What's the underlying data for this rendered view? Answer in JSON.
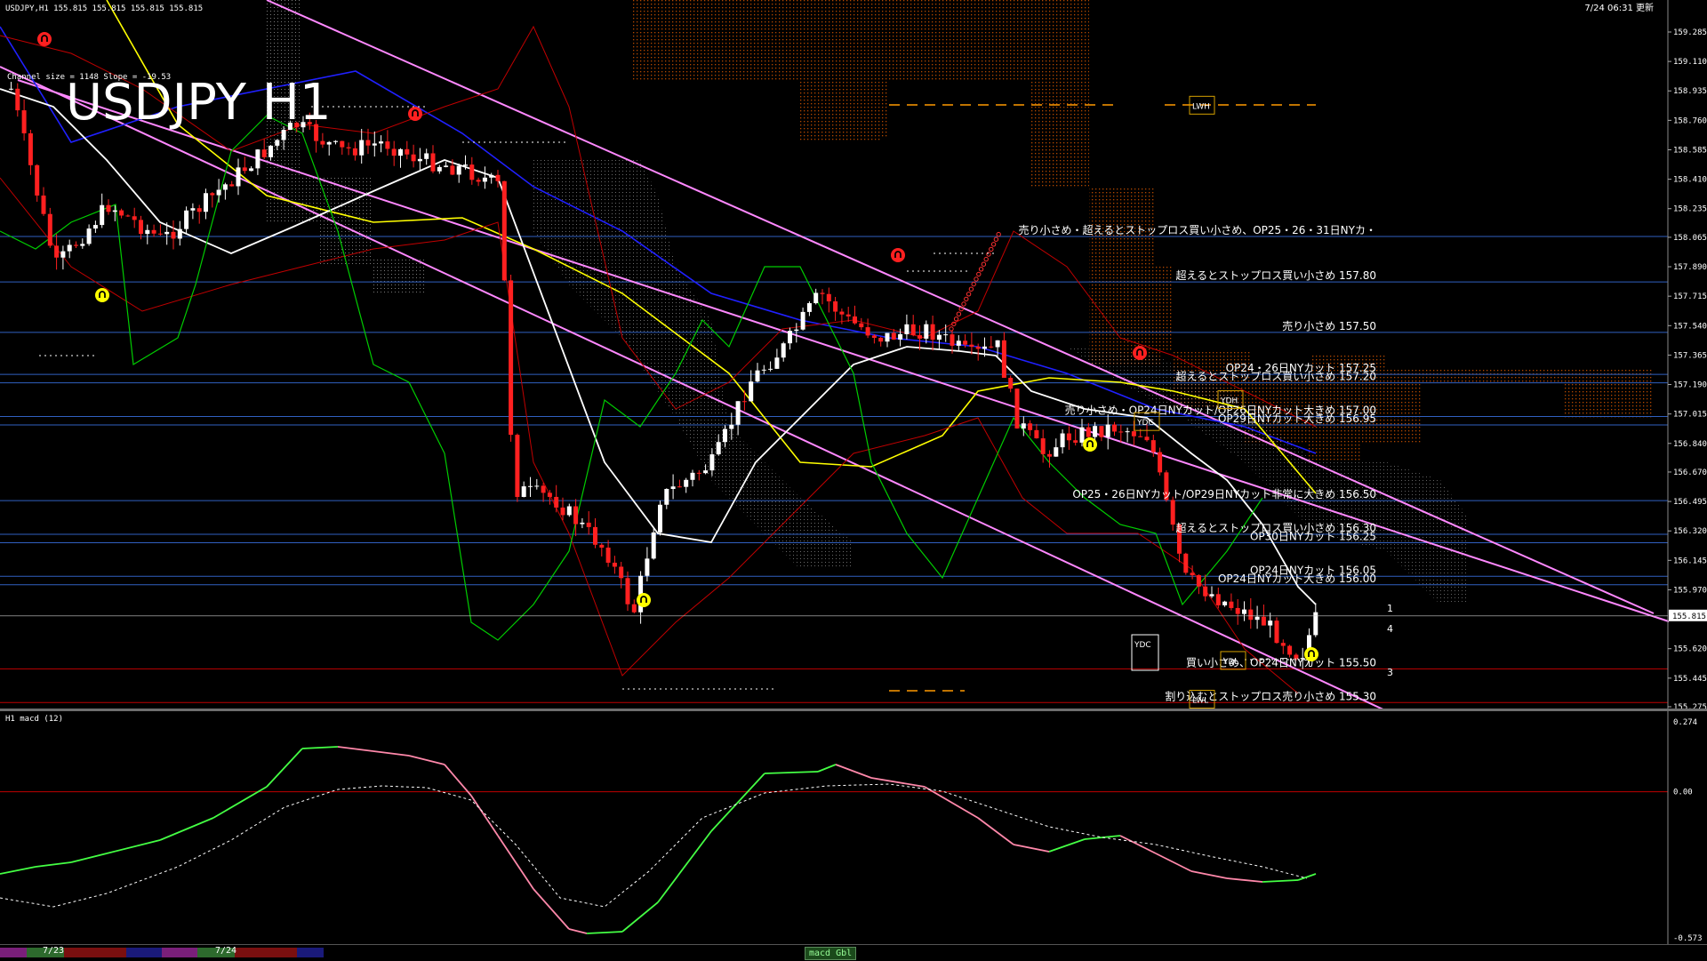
{
  "header": {
    "symbol_info": "USDJPY,H1  155.815 155.815 155.815 155.815",
    "timestamp": "7/24 06:31 更新",
    "channel_info": "Channel size = 1148 Slope = -19.53",
    "big_title": "USDJPY H1"
  },
  "price_axis": [
    {
      "label": "159.285",
      "price": 159.285
    },
    {
      "label": "159.110",
      "price": 159.11
    },
    {
      "label": "158.935",
      "price": 158.935
    },
    {
      "label": "158.760",
      "price": 158.76
    },
    {
      "label": "158.585",
      "price": 158.585
    },
    {
      "label": "158.410",
      "price": 158.41
    },
    {
      "label": "158.235",
      "price": 158.235
    },
    {
      "label": "158.065",
      "price": 158.065
    },
    {
      "label": "157.890",
      "price": 157.89
    },
    {
      "label": "157.715",
      "price": 157.715
    },
    {
      "label": "157.540",
      "price": 157.54
    },
    {
      "label": "157.365",
      "price": 157.365
    },
    {
      "label": "157.190",
      "price": 157.19
    },
    {
      "label": "157.015",
      "price": 157.015
    },
    {
      "label": "156.840",
      "price": 156.84
    },
    {
      "label": "156.670",
      "price": 156.67
    },
    {
      "label": "156.495",
      "price": 156.495
    },
    {
      "label": "156.320",
      "price": 156.32
    },
    {
      "label": "156.145",
      "price": 156.145
    },
    {
      "label": "155.970",
      "price": 155.97
    },
    {
      "label": "155.620",
      "price": 155.62
    },
    {
      "label": "155.445",
      "price": 155.445
    },
    {
      "label": "155.275",
      "price": 155.275
    }
  ],
  "current_price": {
    "label": "155.815",
    "price": 155.815
  },
  "annotations": [
    {
      "text": "売り小さめ・超えるとストップロス買い小さめ、OP25・26・31日NYカ・",
      "price": 158.07
    },
    {
      "text": "超えるとストップロス買い小さめ 157.80",
      "price": 157.8
    },
    {
      "text": "売り小さめ 157.50",
      "price": 157.5
    },
    {
      "text": "OP24・26日NYカット 157.25",
      "price": 157.25
    },
    {
      "text": "超えるとストップロス買い小さめ 157.20",
      "price": 157.2
    },
    {
      "text": "売り小さめ・OP24日NYカット/OP26日NYカット大きめ 157.00",
      "price": 157.0
    },
    {
      "text": "OP29日NYカット大きめ 156.95",
      "price": 156.95
    },
    {
      "text": "OP25・26日NYカット/OP29日NYカット非常に大きめ 156.50",
      "price": 156.5
    },
    {
      "text": "超えるとストップロス買い小さめ 156.30",
      "price": 156.3
    },
    {
      "text": "OP30日NYカット 156.25",
      "price": 156.25
    },
    {
      "text": "OP24日NYカット 156.05",
      "price": 156.05
    },
    {
      "text": "OP24日NYカット大きめ 156.00",
      "price": 156.0
    },
    {
      "text": "買い小さめ、OP24日NYカット 155.50",
      "price": 155.5
    },
    {
      "text": "割り込むとストップロス売り小さめ 155.30",
      "price": 155.3
    }
  ],
  "level_boxes": [
    {
      "text": "LWH",
      "price": 158.85
    },
    {
      "text": "YDH",
      "price": 157.1
    },
    {
      "text": "YDC",
      "price": 156.97
    },
    {
      "text": "YDC",
      "price": 155.65
    },
    {
      "text": "YDL",
      "price": 155.55
    },
    {
      "text": "LWL",
      "price": 155.32
    }
  ],
  "wave_labels": [
    "1",
    "4",
    "3"
  ],
  "macd": {
    "title": "H1  macd (12)",
    "axis": [
      {
        "label": "0.274",
        "value": 0.274
      },
      {
        "label": "0.00",
        "value": 0.0
      },
      {
        "label": "-0.573",
        "value": -0.573
      }
    ],
    "bottom_value": "100000"
  },
  "time_axis": {
    "dates": [
      "7/23",
      "7/24"
    ],
    "tab": "macd Gbl"
  },
  "colors": {
    "background": "#000000",
    "bull": "#ffffff",
    "bear": "#ff2020",
    "sma_white": "#ffffff",
    "sma_yellow": "#ffff00",
    "sma_blue": "#2020ff",
    "bollinger": "#c00000",
    "channel": "#ff88ff",
    "chikou": "#00cc00",
    "kumo": "#c85000",
    "macd_up": "#44ff44",
    "macd_down": "#ff88aa"
  }
}
